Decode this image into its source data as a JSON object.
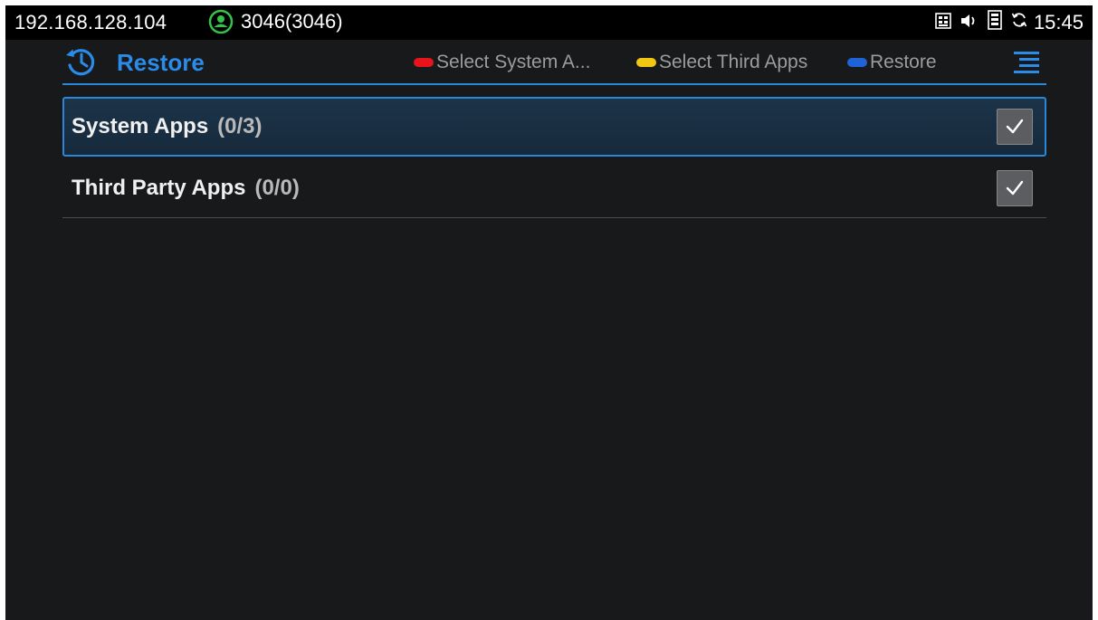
{
  "status_bar": {
    "ip": "192.168.128.104",
    "account": "3046(3046)",
    "account_icon": "account-status-icon",
    "icons": [
      "network-icon",
      "volume-icon",
      "storage-icon",
      "sync-icon"
    ],
    "time": "15:45"
  },
  "header": {
    "title": "Restore",
    "title_icon": "history-restore-icon",
    "menu_icon": "menu-icon",
    "hints": [
      {
        "color": "#e8141b",
        "label": "Select System A..."
      },
      {
        "color": "#f2c713",
        "label": "Select Third Apps"
      },
      {
        "color": "#1f63d6",
        "label": "Restore"
      }
    ]
  },
  "list": {
    "items": [
      {
        "label": "System Apps",
        "count": "(0/3)",
        "checked": true,
        "selected": true
      },
      {
        "label": "Third Party Apps",
        "count": "(0/0)",
        "checked": true,
        "selected": false
      }
    ]
  },
  "colors": {
    "accent": "#2a8be8",
    "background": "#17191b",
    "status_bar": "#000000",
    "account_green": "#35c14a"
  }
}
